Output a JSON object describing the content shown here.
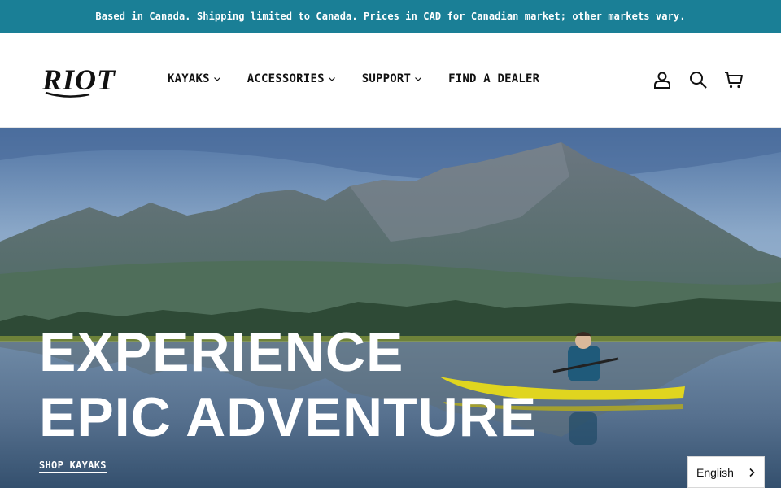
{
  "announcement": {
    "text": "Based in Canada. Shipping limited to Canada. Prices in CAD for Canadian market; other markets vary."
  },
  "brand": {
    "name": "Riot"
  },
  "nav": {
    "items": [
      {
        "label": "KAYAKS",
        "has_dropdown": true
      },
      {
        "label": "ACCESSORIES",
        "has_dropdown": true
      },
      {
        "label": "SUPPORT",
        "has_dropdown": true
      },
      {
        "label": "FIND A DEALER",
        "has_dropdown": false
      }
    ]
  },
  "header_icons": [
    "account-icon",
    "search-icon",
    "cart-icon"
  ],
  "hero": {
    "title_line1": "EXPERIENCE",
    "title_line2": "EPIC ADVENTURE",
    "cta_label": "SHOP KAYAKS"
  },
  "language": {
    "selected": "English"
  },
  "colors": {
    "announcement_bg": "#1a7f96",
    "text_dark": "#111111",
    "kayak_yellow": "#e0d51f"
  }
}
